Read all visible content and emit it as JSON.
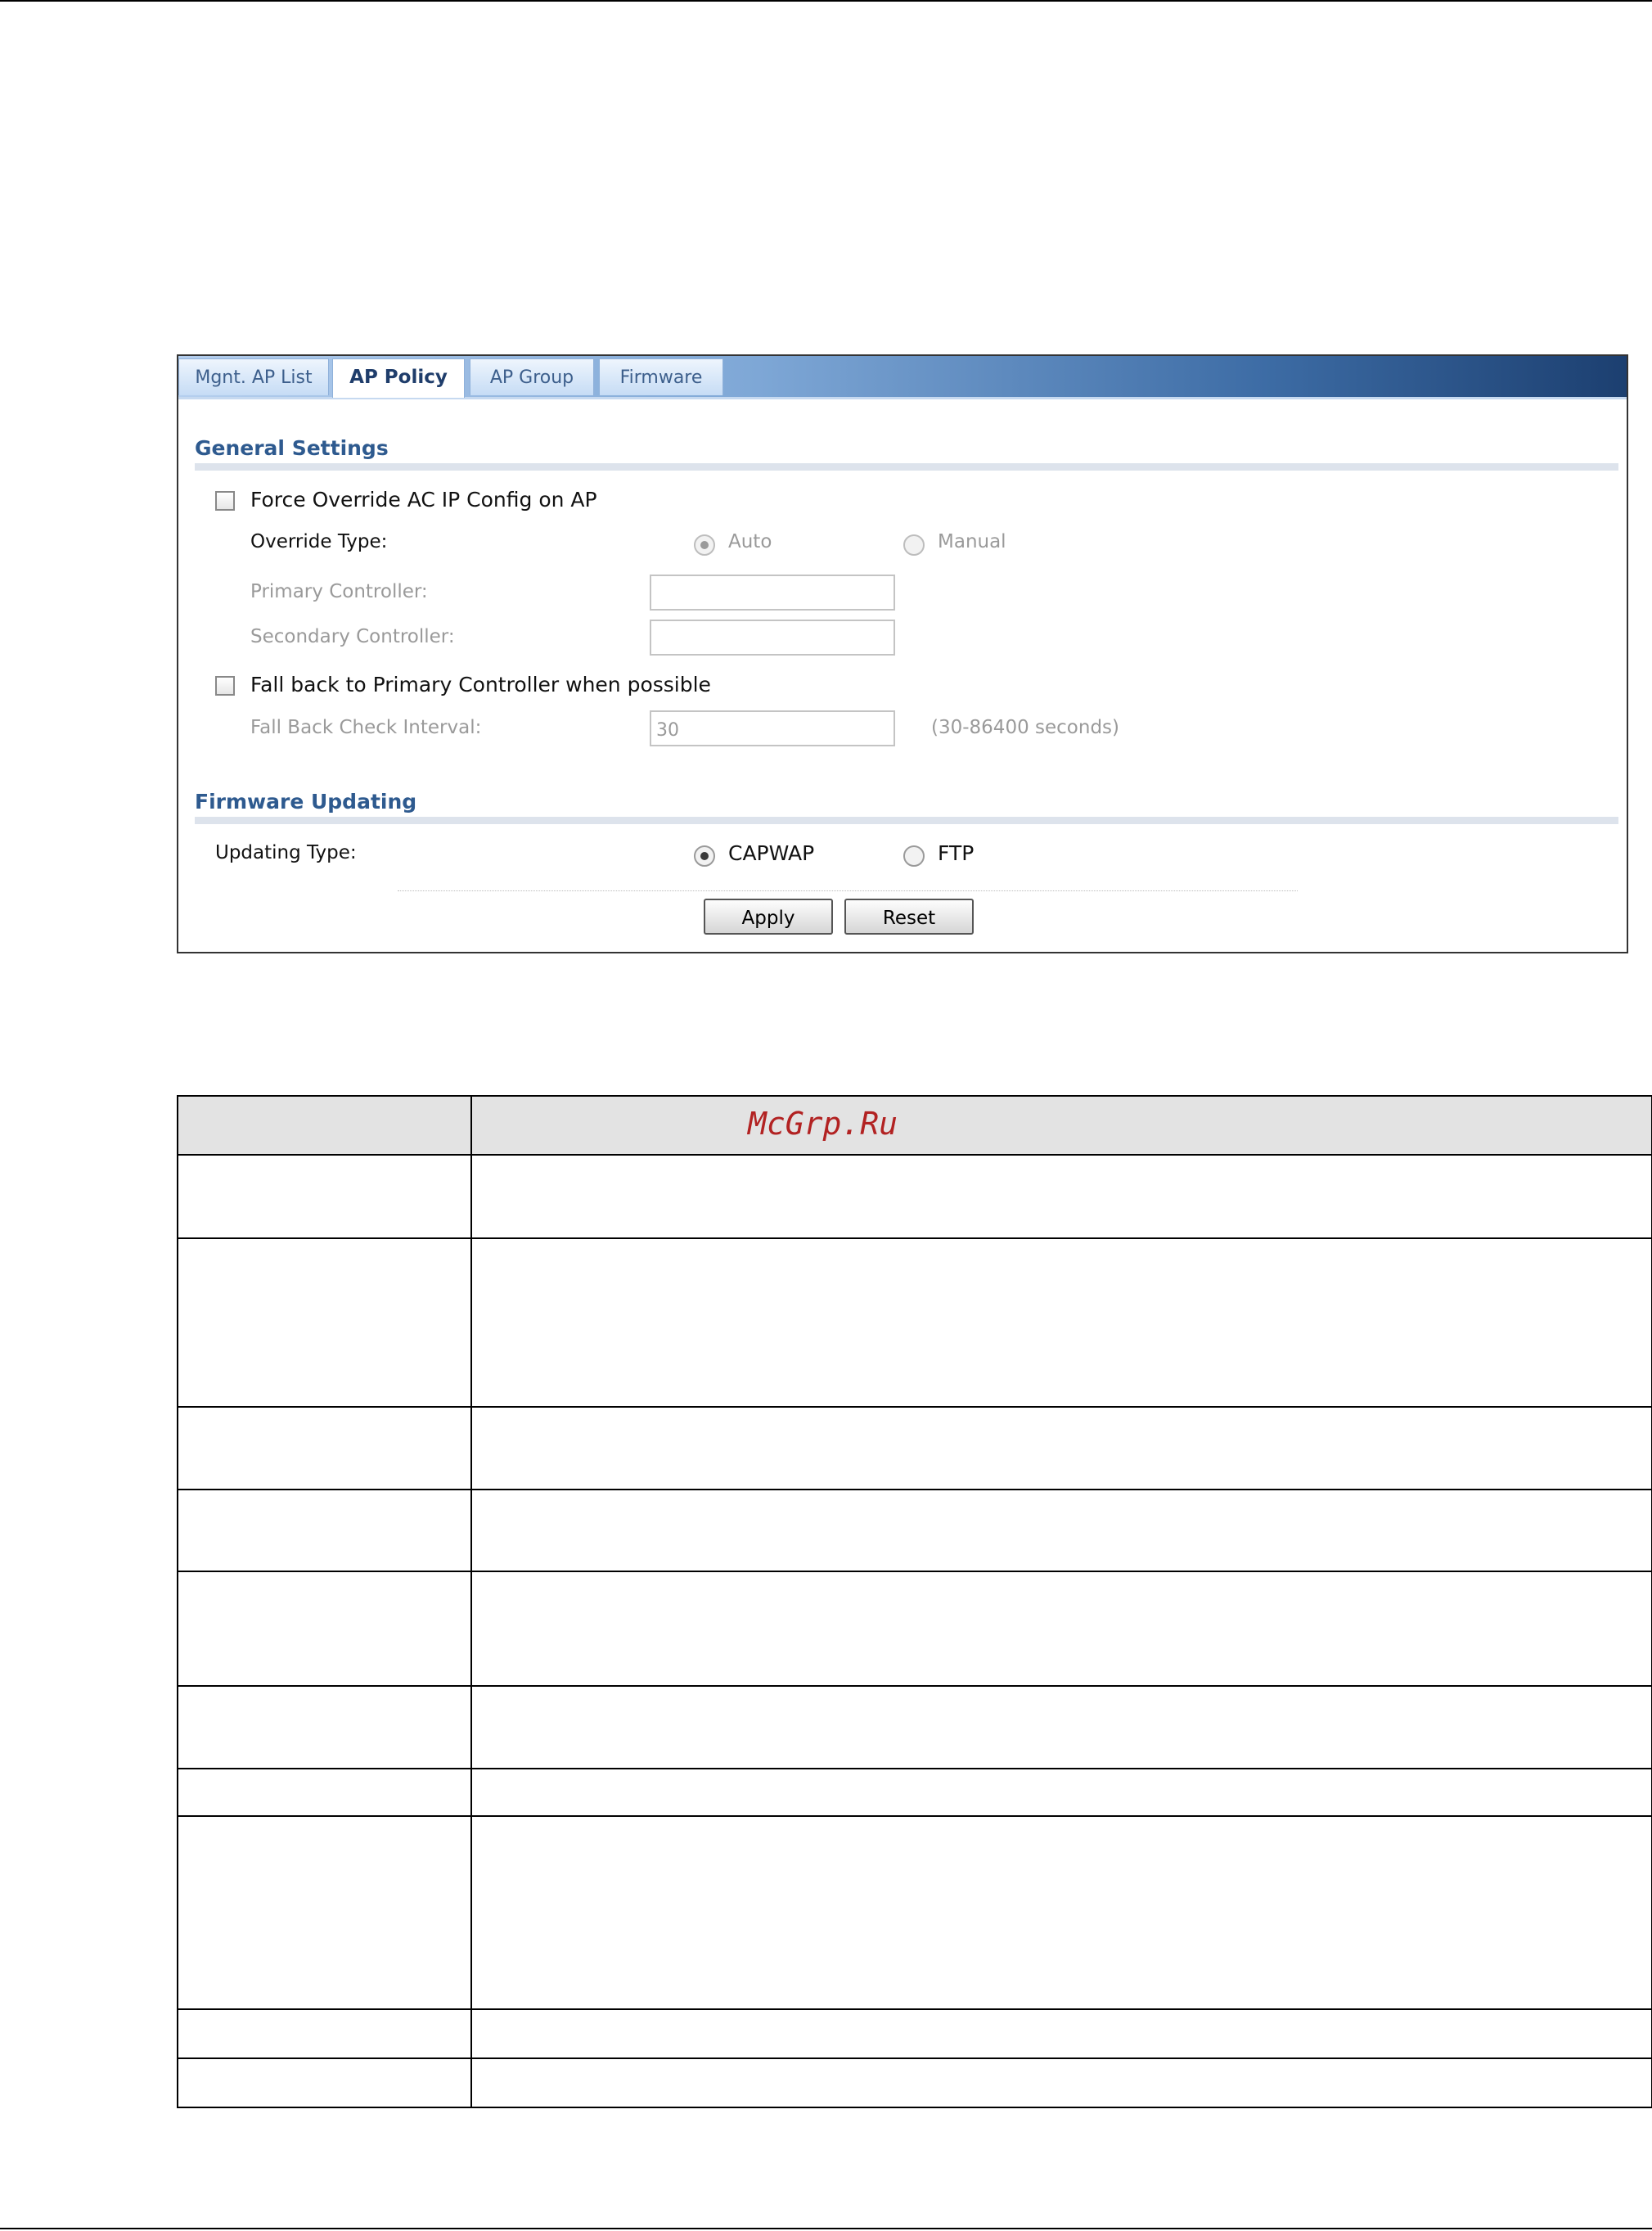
{
  "tabs": [
    {
      "label": "Mgnt. AP List",
      "active": false
    },
    {
      "label": "AP Policy",
      "active": true
    },
    {
      "label": "AP Group",
      "active": false
    },
    {
      "label": "Firmware",
      "active": false
    }
  ],
  "general": {
    "title": "General Settings",
    "force_override_label": "Force Override AC IP Config on AP",
    "force_override_checked": false,
    "override_type_label": "Override Type:",
    "override_auto_label": "Auto",
    "override_manual_label": "Manual",
    "override_selected": "Auto",
    "primary_controller_label": "Primary Controller:",
    "primary_controller_value": "",
    "secondary_controller_label": "Secondary Controller:",
    "secondary_controller_value": "",
    "fallback_label": "Fall back to Primary Controller when possible",
    "fallback_checked": false,
    "fallback_interval_label": "Fall Back Check Interval:",
    "fallback_interval_value": "30",
    "fallback_interval_hint": "(30-86400 seconds)"
  },
  "firmware": {
    "title": "Firmware Updating",
    "updating_type_label": "Updating Type:",
    "capwap_label": "CAPWAP",
    "ftp_label": "FTP",
    "selected": "CAPWAP"
  },
  "buttons": {
    "apply_label": "Apply",
    "reset_label": "Reset"
  },
  "table": {
    "header": [
      "",
      ""
    ],
    "rows": [
      [
        "",
        ""
      ],
      [
        "",
        ""
      ],
      [
        "",
        ""
      ],
      [
        "",
        ""
      ],
      [
        "",
        ""
      ],
      [
        "",
        ""
      ],
      [
        "",
        ""
      ],
      [
        "",
        ""
      ],
      [
        "",
        ""
      ],
      [
        "",
        ""
      ]
    ]
  },
  "watermark": "McGrp.Ru"
}
